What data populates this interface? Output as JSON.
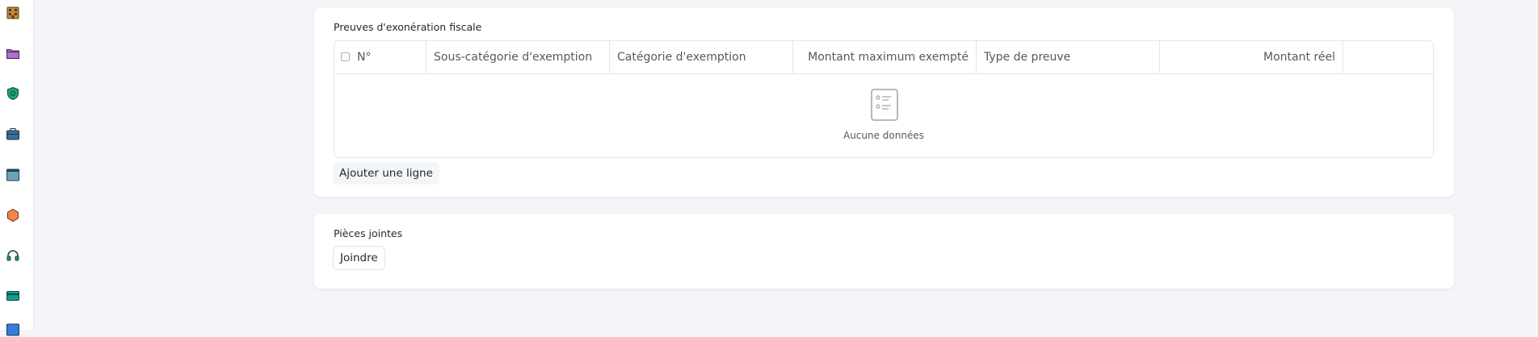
{
  "sidebar": {
    "icons": [
      {
        "name": "building-icon",
        "color": "#c08a3e"
      },
      {
        "name": "folder-icon",
        "color": "#b06fd0"
      },
      {
        "name": "shield-icon",
        "color": "#1aa37a"
      },
      {
        "name": "briefcase-icon",
        "color": "#3c6e91"
      },
      {
        "name": "window-icon",
        "color": "#6ea2b8"
      },
      {
        "name": "hexagon-icon",
        "color": "#f0884b"
      },
      {
        "name": "headset-icon",
        "color": "#2f8f7a"
      },
      {
        "name": "card-icon",
        "color": "#179c8e"
      },
      {
        "name": "app-icon",
        "color": "#3a7bd5"
      }
    ]
  },
  "exemption_proofs": {
    "title": "Preuves d'exonération fiscale",
    "columns": {
      "index": "N°",
      "sub_category": "Sous-catégorie d'exemption",
      "category": "Catégorie d'exemption",
      "max_amount": "Montant maximum exempté",
      "proof_type": "Type de preuve",
      "actual_amount": "Montant réel"
    },
    "empty_text": "Aucune données",
    "add_row_label": "Ajouter une ligne"
  },
  "attachments": {
    "title": "Pièces jointes",
    "attach_label": "Joindre"
  }
}
